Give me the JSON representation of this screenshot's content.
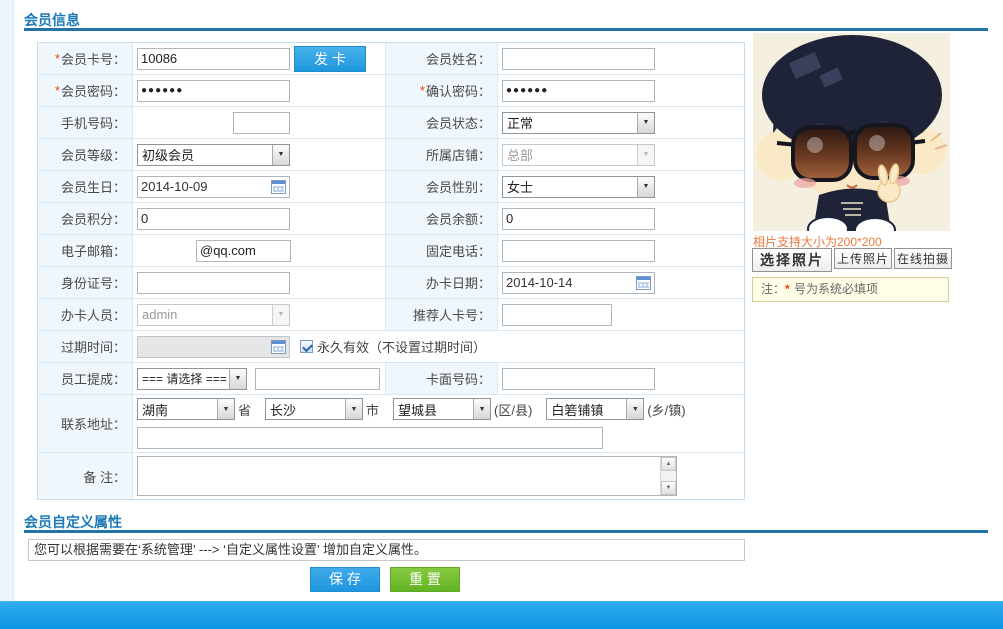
{
  "colors": {
    "accent_blue": "#1E96DC",
    "header_blue": "#1B79B8",
    "save_blue": "#1F96DF",
    "reset_green": "#64B424",
    "footer_blue": "#0E95E4",
    "required_red": "#FF3C00",
    "photo_hint_orange": "#E9793E",
    "note_bg_yellow": "#FEFEE8",
    "label_cell_bg": "#EFF6FC"
  },
  "sections": {
    "member_info_title": "会员信息",
    "custom_attr_title": "会员自定义属性",
    "custom_attr_hint": "您可以根据需要在‘系统管理’ ---> ‘自定义属性设置’ 增加自定义属性。"
  },
  "actions": {
    "issue_card": "发 卡",
    "save": "保 存",
    "reset": "重 置"
  },
  "form": {
    "member_card_no": {
      "label": "会员卡号：",
      "star": "*",
      "value": "10086"
    },
    "member_name": {
      "label": "会员姓名：",
      "value": ""
    },
    "member_password": {
      "label": "会员密码：",
      "star": "*",
      "value": "●●●●●●"
    },
    "confirm_password": {
      "label": "确认密码：",
      "star": "*",
      "value": "●●●●●●"
    },
    "mobile": {
      "label": "手机号码：",
      "value": ""
    },
    "member_status": {
      "label": "会员状态：",
      "selected": "正常"
    },
    "member_level": {
      "label": "会员等级：",
      "selected": "初级会员"
    },
    "store": {
      "label": "所属店铺：",
      "selected": "总部"
    },
    "birthday": {
      "label": "会员生日：",
      "value": "2014-10-09"
    },
    "gender": {
      "label": "会员性别：",
      "selected": "女士"
    },
    "points": {
      "label": "会员积分：",
      "value": "0"
    },
    "balance": {
      "label": "会员余额：",
      "value": "0"
    },
    "email": {
      "label": "电子邮箱：",
      "value": "@qq.com"
    },
    "landline": {
      "label": "固定电话：",
      "value": ""
    },
    "id_number": {
      "label": "身份证号：",
      "value": ""
    },
    "issue_date": {
      "label": "办卡日期：",
      "value": "2014-10-14"
    },
    "operator": {
      "label": "办卡人员：",
      "selected": "admin"
    },
    "referrer_card_no": {
      "label": "推荐人卡号：",
      "value": ""
    },
    "expire_time": {
      "label": "过期时间：",
      "value": "",
      "checkbox_label": "永久有效（不设置过期时间）"
    },
    "staff_commission": {
      "label": "员工提成：",
      "selected": "=== 请选择 ===",
      "value": ""
    },
    "card_face_no": {
      "label": "卡面号码：",
      "value": ""
    },
    "address": {
      "label": "联系地址：",
      "province": "湖南",
      "province_suffix": "省",
      "city": "长沙",
      "city_suffix": "市",
      "district": "望城县",
      "district_suffix": "(区/县)",
      "town": "白箬铺镇",
      "town_suffix": "(乡/镇)",
      "detail": ""
    },
    "remark": {
      "label": "备 注：",
      "value": ""
    }
  },
  "photo_panel": {
    "size_hint": "相片支持大小为200*200",
    "choose_photo": "选择照片",
    "upload_photo": "上传照片",
    "online_capture": "在线拍摄",
    "note_prefix": "注：",
    "note_star": "*",
    "note_text": " 号为系统必填项"
  }
}
